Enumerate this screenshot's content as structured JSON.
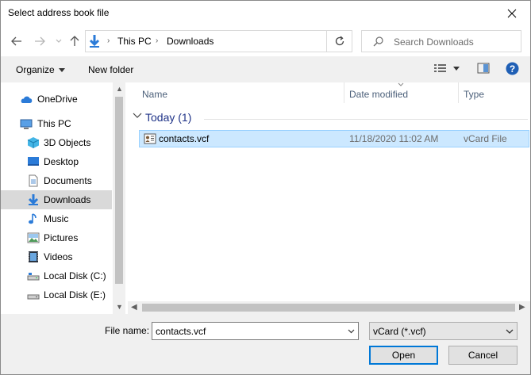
{
  "window": {
    "title": "Select address book file"
  },
  "address": {
    "crumbs": [
      "This PC",
      "Downloads"
    ],
    "search_placeholder": "Search Downloads"
  },
  "toolbar": {
    "organize": "Organize",
    "new_folder": "New folder"
  },
  "nav": {
    "items": [
      {
        "label": "OneDrive",
        "icon": "onedrive-icon"
      },
      {
        "label": "This PC",
        "icon": "computer-icon"
      },
      {
        "label": "3D Objects",
        "icon": "cube-icon"
      },
      {
        "label": "Desktop",
        "icon": "desktop-icon"
      },
      {
        "label": "Documents",
        "icon": "document-icon"
      },
      {
        "label": "Downloads",
        "icon": "download-icon",
        "selected": true
      },
      {
        "label": "Music",
        "icon": "music-icon"
      },
      {
        "label": "Pictures",
        "icon": "pictures-icon"
      },
      {
        "label": "Videos",
        "icon": "video-icon"
      },
      {
        "label": "Local Disk (C:)",
        "icon": "disk-icon"
      },
      {
        "label": "Local Disk (E:)",
        "icon": "disk-icon"
      }
    ]
  },
  "files": {
    "columns": [
      "Name",
      "Date modified",
      "Type"
    ],
    "group": "Today (1)",
    "rows": [
      {
        "name": "contacts.vcf",
        "date": "11/18/2020 11:02 AM",
        "type": "vCard File"
      }
    ]
  },
  "footer": {
    "filename_label": "File name:",
    "filename_value": "contacts.vcf",
    "filetype_value": "vCard (*.vcf)",
    "open_label": "Open",
    "cancel_label": "Cancel"
  },
  "colors": {
    "accent": "#0078d7",
    "selection": "#cce8ff",
    "selection_border": "#99d1ff"
  }
}
